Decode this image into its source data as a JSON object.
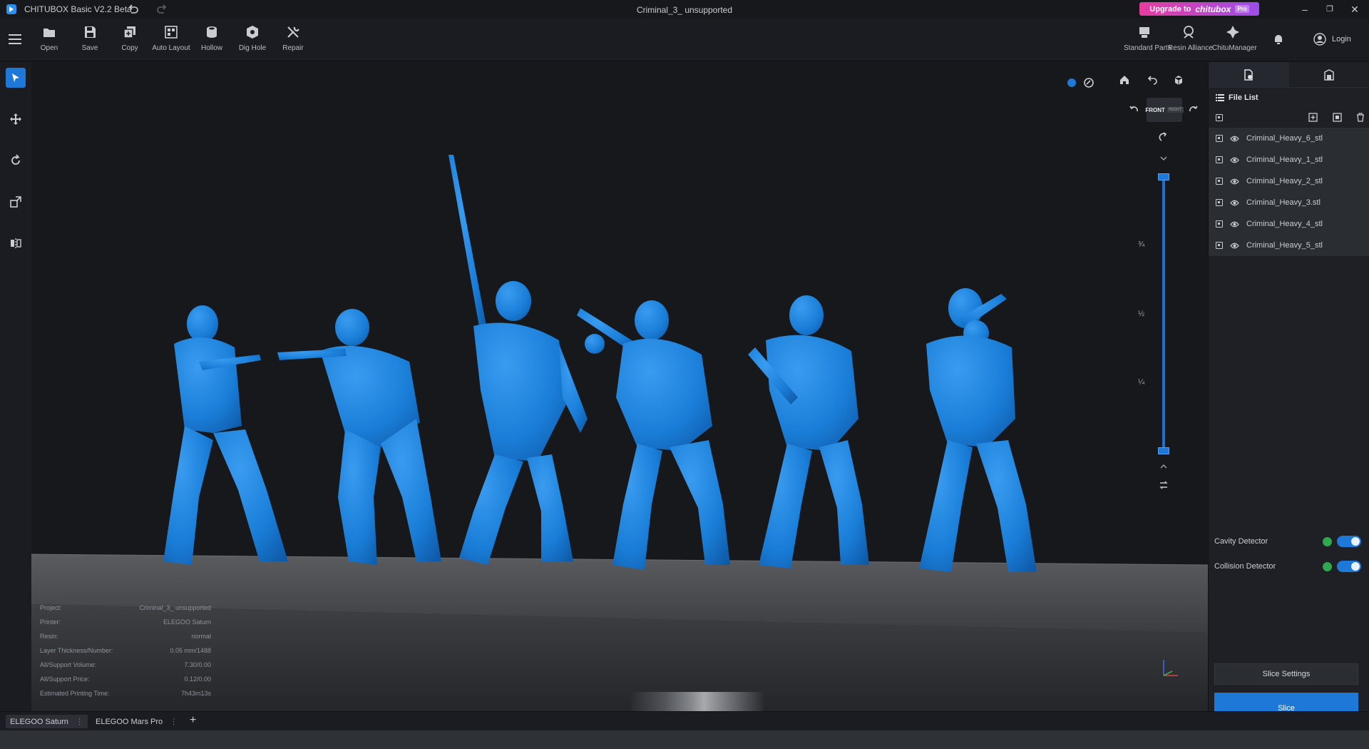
{
  "app": {
    "title": "CHITUBOX Basic V2.2 Beta",
    "document_title": "Criminal_3_ unsupported",
    "upgrade": {
      "prefix": "Upgrade to",
      "brand": "chitubox",
      "tier": "Pro"
    },
    "accent_color": "#1d78d8",
    "model_color": "#1a7ed8"
  },
  "toolbar": {
    "tools": [
      {
        "label": "Open",
        "icon": "folder-icon"
      },
      {
        "label": "Save",
        "icon": "save-icon"
      },
      {
        "label": "Copy",
        "icon": "copy-icon"
      },
      {
        "label": "Auto Layout",
        "icon": "auto-layout-icon"
      },
      {
        "label": "Hollow",
        "icon": "hollow-icon"
      },
      {
        "label": "Dig Hole",
        "icon": "dig-hole-icon"
      },
      {
        "label": "Repair",
        "icon": "repair-icon"
      }
    ],
    "right_tools": [
      {
        "label": "Standard Parts",
        "icon": "standard-parts-icon"
      },
      {
        "label": "Resin Alliance",
        "icon": "resin-alliance-icon"
      },
      {
        "label": "ChituManager",
        "icon": "chitumanager-icon"
      }
    ],
    "login_label": "Login"
  },
  "viewport": {
    "view_cube": {
      "front": "FRONT",
      "side": "RIGHT"
    },
    "height_fractions": [
      "¾",
      "½",
      "¼"
    ]
  },
  "project_info": [
    {
      "label": "Project:",
      "value": "Criminal_3_ unsupported"
    },
    {
      "label": "Printer:",
      "value": "ELEGOO Saturn"
    },
    {
      "label": "Resin:",
      "value": "normal"
    },
    {
      "label": "Layer Thickness/Number:",
      "value": "0.05 mm/1488"
    },
    {
      "label": "All/Support Volume:",
      "value": "7.30/0.00"
    },
    {
      "label": "All/Support Price:",
      "value": "0.12/0.00"
    },
    {
      "label": "Estimated Printing Time:",
      "value": "7h43m13s"
    }
  ],
  "file_list": {
    "title": "File List",
    "files": [
      "Criminal_Heavy_6_stl",
      "Criminal_Heavy_1_stl",
      "Criminal_Heavy_2_stl",
      "Criminal_Heavy_3.stl",
      "Criminal_Heavy_4_stl",
      "Criminal_Heavy_5_stl"
    ]
  },
  "detectors": [
    {
      "label": "Cavity Detector",
      "enabled": true
    },
    {
      "label": "Collision Detector",
      "enabled": true
    }
  ],
  "buttons": {
    "slice_settings": "Slice Settings",
    "slice": "Slice"
  },
  "printers": [
    "ELEGOO Saturn",
    "ELEGOO Mars Pro"
  ],
  "add_printer": "+"
}
